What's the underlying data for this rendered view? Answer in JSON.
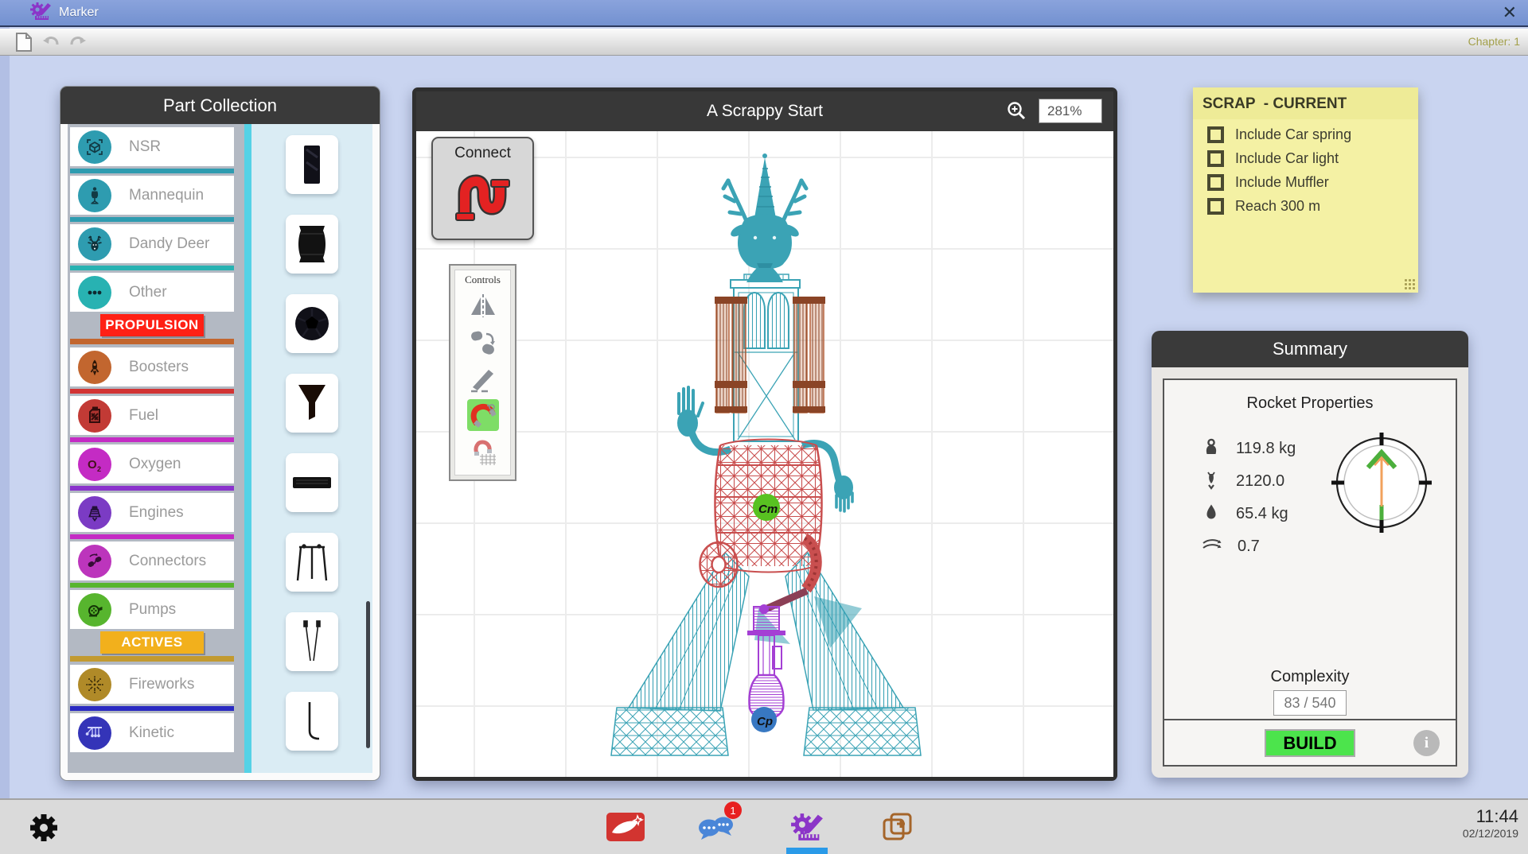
{
  "titlebar": {
    "app_name": "Marker",
    "close_glyph": "✕"
  },
  "menubar": {
    "chapter_label": "Chapter: 1"
  },
  "part_collection": {
    "title": "Part Collection",
    "rows": [
      {
        "kind": "category",
        "label": "NSR",
        "color": "#2E9CB0",
        "divider": "#2E9CB0"
      },
      {
        "kind": "category",
        "label": "Mannequin",
        "color": "#2E9CB0",
        "divider": "#2E9CB0"
      },
      {
        "kind": "category",
        "label": "Dandy Deer",
        "color": "#2E9CB0",
        "divider": "#28B2B2"
      },
      {
        "kind": "category",
        "label": "Other",
        "color": "#28B2B2",
        "divider": ""
      },
      {
        "kind": "section",
        "label": "PROPULSION",
        "badge_color": "#FF2015",
        "bar_color": "#C2662F"
      },
      {
        "kind": "category",
        "label": "Boosters",
        "color": "#C2662F",
        "divider": "#D23434"
      },
      {
        "kind": "category",
        "label": "Fuel",
        "color": "#C23A35",
        "divider": "#C42BC4"
      },
      {
        "kind": "category",
        "label": "Oxygen",
        "color": "#C42BC4",
        "divider": "#8A33CC"
      },
      {
        "kind": "category",
        "label": "Engines",
        "color": "#7B3BC4",
        "divider": "#C42BC4"
      },
      {
        "kind": "category",
        "label": "Connectors",
        "color": "#BC35BC",
        "divider": "#57B52E"
      },
      {
        "kind": "category",
        "label": "Pumps",
        "color": "#57B52E",
        "divider": ""
      },
      {
        "kind": "section",
        "label": "ACTIVES",
        "badge_color": "#F2B01C",
        "bar_color": "#C29A30"
      },
      {
        "kind": "category",
        "label": "Fireworks",
        "color": "#B08A28",
        "divider": "#2A2AC2"
      },
      {
        "kind": "category",
        "label": "Kinetic",
        "color": "#3434B8",
        "divider": ""
      }
    ],
    "thumbnails": [
      "dark-panel",
      "dark-barrel",
      "dark-ball",
      "funnel",
      "dark-bar",
      "swing-frame",
      "wire-pair",
      "bent-rod"
    ]
  },
  "canvas": {
    "title": "A Scrappy Start",
    "zoom_value": "281%",
    "connect_label": "Connect",
    "controls_title": "Controls",
    "com_label": "Cm",
    "cop_label": "Cp"
  },
  "note": {
    "title": "SCRAP  - CURRENT",
    "tasks": [
      "Include Car spring",
      "Include Car light",
      "Include Muffler",
      "Reach 300 m"
    ]
  },
  "summary": {
    "title": "Summary",
    "subtitle": "Rocket Properties",
    "stats": [
      {
        "icon": "mass-icon",
        "value": "119.8 kg"
      },
      {
        "icon": "thrust-icon",
        "value": "2120.0"
      },
      {
        "icon": "fuel-icon",
        "value": "65.4 kg"
      },
      {
        "icon": "aero-icon",
        "value": "0.7"
      }
    ],
    "complexity_label": "Complexity",
    "complexity_value": "83 / 540",
    "build_label": "BUILD",
    "info_glyph": "i"
  },
  "taskbar": {
    "chat_badge": "1",
    "clock_time": "11:44",
    "clock_date": "02/12/2019"
  }
}
